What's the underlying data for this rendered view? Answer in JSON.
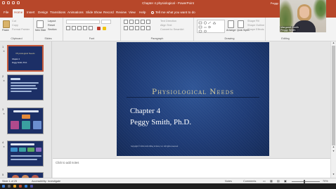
{
  "app": {
    "window_title": "Chapter 4 physiological  -  PowerPoint",
    "user_partial": "Peggy"
  },
  "tabs": [
    "File",
    "Home",
    "Insert",
    "Design",
    "Transitions",
    "Animations",
    "Slide Show",
    "Record",
    "Review",
    "View",
    "Help"
  ],
  "tell_me": "Tell me what you want to do",
  "ribbon": {
    "groups": [
      "Clipboard",
      "Slides",
      "Font",
      "Paragraph",
      "Drawing",
      "Editing"
    ],
    "clipboard": {
      "paste": "Paste",
      "cut": "Cut",
      "copy": "Copy",
      "format_painter": "Format Painter"
    },
    "slides": {
      "new_slide": "New Slide",
      "layout": "Layout",
      "reset": "Reset",
      "section": "Section"
    },
    "paragraph": {
      "text_direction": "Text Direction",
      "align_text": "Align Text",
      "convert_smartart": "Convert to SmartArt"
    },
    "drawing": {
      "arrange": "Arrange",
      "quick_styles": "Quick Styles",
      "shape_fill": "Shape Fill",
      "shape_outline": "Shape Outline",
      "shape_effects": "Shape Effects"
    }
  },
  "thumbnails": [
    {
      "num": "1",
      "title": "Physiological Needs",
      "line1": "Chapter 4",
      "line2": "Peggy Smith, Ph.D."
    },
    {
      "num": "2"
    },
    {
      "num": "3"
    },
    {
      "num": "4"
    },
    {
      "num": "5"
    }
  ],
  "slide": {
    "title": "Physiological Needs",
    "subtitle_line1": "Chapter 4",
    "subtitle_line2": "Peggy Smith, Ph.D.",
    "copyright": "Copyright © 2014 John Wiley & Sons, Inc. All rights reserved."
  },
  "notes_placeholder": "Click to add notes",
  "status": {
    "slide_count": "Slide 1 of 25",
    "accessibility": "Accessibility: Investigate",
    "notes": "Notes",
    "comments": "Comments",
    "zoom": "70%"
  },
  "webcam": {
    "name_line1": "Margaret Smith",
    "name_line2": "Peggy Smith"
  },
  "colors": {
    "accent": "#b7472a",
    "slide_bg": "#1f3c77",
    "title_gold": "#d7cc9c"
  }
}
